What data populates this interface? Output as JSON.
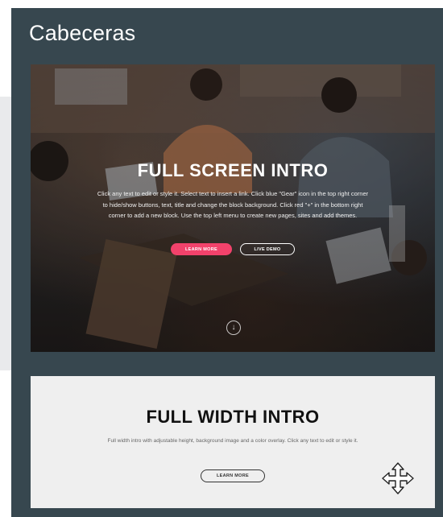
{
  "panel": {
    "title": "Cabeceras",
    "background_color": "#37474f"
  },
  "blocks": [
    {
      "title": "FULL SCREEN INTRO",
      "description": "Click any text to edit or style it. Select text to insert a link. Click blue \"Gear\" icon in the top right corner to hide/show buttons, text, title and change the block background. Click red \"+\" in the bottom right corner to add a new block. Use the top left menu to create new pages, sites and add themes.",
      "primary_button": "LEARN MORE",
      "secondary_button": "LIVE DEMO",
      "scroll_icon": "arrow-down-icon",
      "accent_color": "#f2426b"
    },
    {
      "title": "FULL WIDTH INTRO",
      "description": "Full width intro with adjustable height, background image and a color overlay. Click any text to edit or style it.",
      "button": "LEARN MORE",
      "drag_icon": "move-arrows-icon"
    }
  ]
}
